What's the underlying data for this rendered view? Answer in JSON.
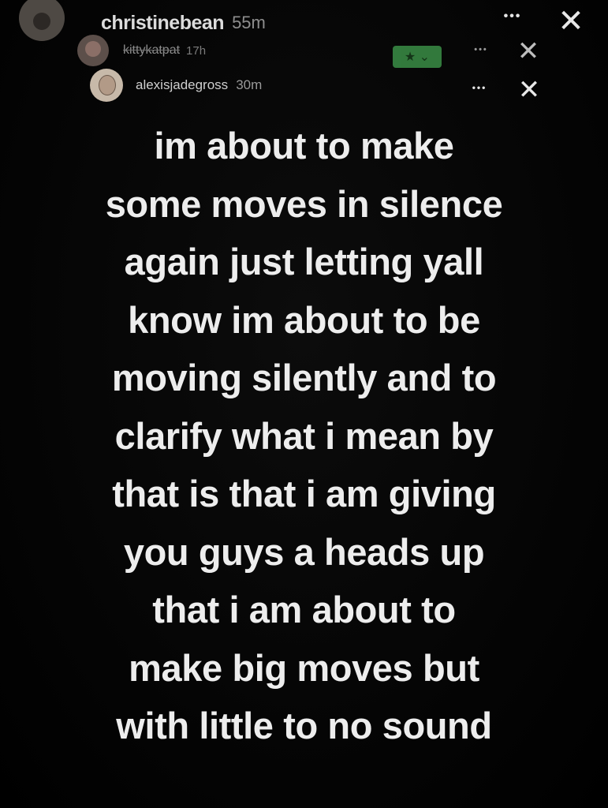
{
  "story": {
    "header_rows": [
      {
        "username": "christinebean",
        "timestamp": "55m"
      },
      {
        "username": "kittykatpat",
        "timestamp": "17h"
      },
      {
        "username": "alexisjadegross",
        "timestamp": "30m"
      }
    ],
    "controls": {
      "more_glyph": "•••",
      "close_glyph": "✕",
      "rating_glyph": "★ ⌄"
    },
    "text_lines": [
      "im about to make",
      "some moves in silence",
      "again just letting yall",
      "know im about to be",
      "moving silently and to",
      "clarify what i mean by",
      "that is that i am giving",
      "you guys a heads up",
      "that i am about to",
      "make big moves but",
      "with little to no sound"
    ]
  },
  "colors": {
    "background": "#000000",
    "text": "#ededed",
    "accent_green": "#3a8e46"
  }
}
